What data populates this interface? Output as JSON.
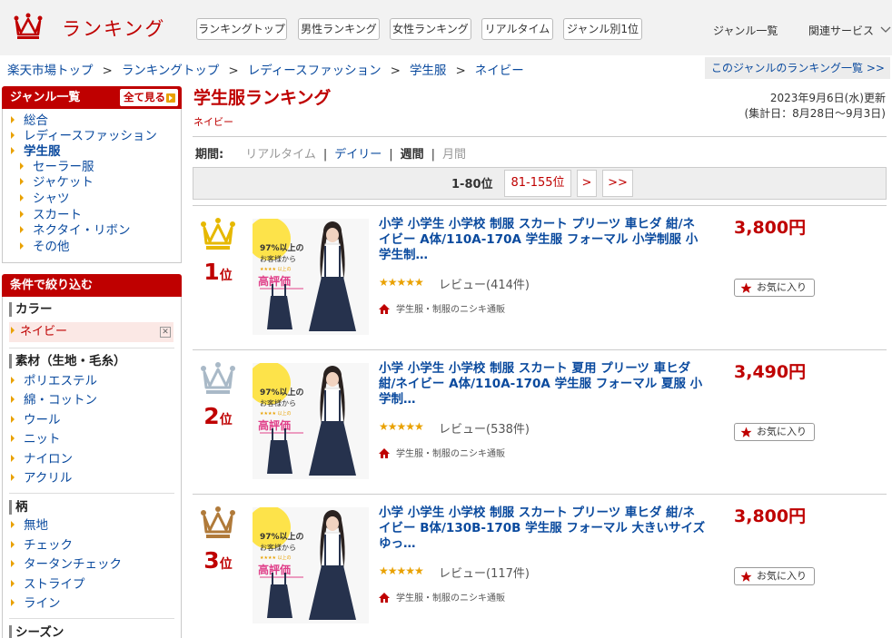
{
  "header": {
    "logo_text": "ランキング",
    "nav": [
      "ランキングトップ",
      "男性ランキング",
      "女性ランキング",
      "リアルタイム",
      "ジャンル別1位"
    ],
    "genre_list": "ジャンル一覧",
    "related": "関連サービス",
    "accent_color": "#bf0000"
  },
  "breadcrumb": {
    "items": [
      "楽天市場トップ",
      "ランキングトップ",
      "レディースファッション",
      "学生服",
      "ネイビー"
    ],
    "separator": ">",
    "right_link": "このジャンルのランキング一覧 >>"
  },
  "sidebar": {
    "genre_header": "ジャンル一覧",
    "all_button": "全て見る",
    "genres": [
      "総合",
      "レディースファッション",
      "学生服"
    ],
    "subgenres": [
      "セーラー服",
      "ジャケット",
      "シャツ",
      "スカート",
      "ネクタイ・リボン",
      "その他"
    ],
    "filter_header": "条件で絞り込む",
    "color_label": "カラー",
    "color_selected": "ネイビー",
    "material_label": "素材（生地・毛糸）",
    "materials": [
      "ポリエステル",
      "綿・コットン",
      "ウール",
      "ニット",
      "ナイロン",
      "アクリル"
    ],
    "pattern_label": "柄",
    "patterns": [
      "無地",
      "チェック",
      "タータンチェック",
      "ストライプ",
      "ライン"
    ],
    "season_label": "シーズン"
  },
  "main": {
    "title": "学生服ランキング",
    "subtitle": "ネイビー",
    "updated": "2023年9月6日(水)更新",
    "period_range": "(集計日：8月28日〜9月3日)",
    "period_label": "期間:",
    "periods": [
      "リアルタイム",
      "デイリー",
      "週間",
      "月間"
    ],
    "pager": {
      "current": "1-80位",
      "next_range": "81-155位",
      "next": ">",
      "last": ">>"
    }
  },
  "image_text": {
    "line1": "97%以上の",
    "line2": "お客様から",
    "line3": "★★★★ 以上の",
    "line4": "高評価"
  },
  "rankings": [
    {
      "rank": "1",
      "rank_suffix": "位",
      "crown": "gold",
      "crown_color": "#e6b800",
      "title": "小学 小学生 小学校 制服 スカート プリーツ 車ヒダ 紺/ネイビー A体/110A-170A 学生服 フォーマル 小学制服 小学生制…",
      "stars": "★★★★★",
      "rating": 4.5,
      "review": "レビュー(414件)",
      "shop": "学生服・制服のニシキ通販",
      "price": "3,800円",
      "fav": "お気に入り"
    },
    {
      "rank": "2",
      "rank_suffix": "位",
      "crown": "silver",
      "crown_color": "#a9b9c7",
      "title": "小学 小学生 小学校 制服 スカート 夏用 プリーツ 車ヒダ 紺/ネイビー A体/110A-170A 学生服 フォーマル 夏服 小学制…",
      "stars": "★★★★★",
      "rating": 4.5,
      "review": "レビュー(538件)",
      "shop": "学生服・制服のニシキ通販",
      "price": "3,490円",
      "fav": "お気に入り"
    },
    {
      "rank": "3",
      "rank_suffix": "位",
      "crown": "bronze",
      "crown_color": "#b07a3a",
      "title": "小学 小学生 小学校 制服 スカート プリーツ 車ヒダ 紺/ネイビー B体/130B-170B 学生服 フォーマル 大きいサイズ ゆっ…",
      "stars": "★★★★★",
      "rating": 4.5,
      "review": "レビュー(117件)",
      "shop": "学生服・制服のニシキ通販",
      "price": "3,800円",
      "fav": "お気に入り"
    }
  ]
}
